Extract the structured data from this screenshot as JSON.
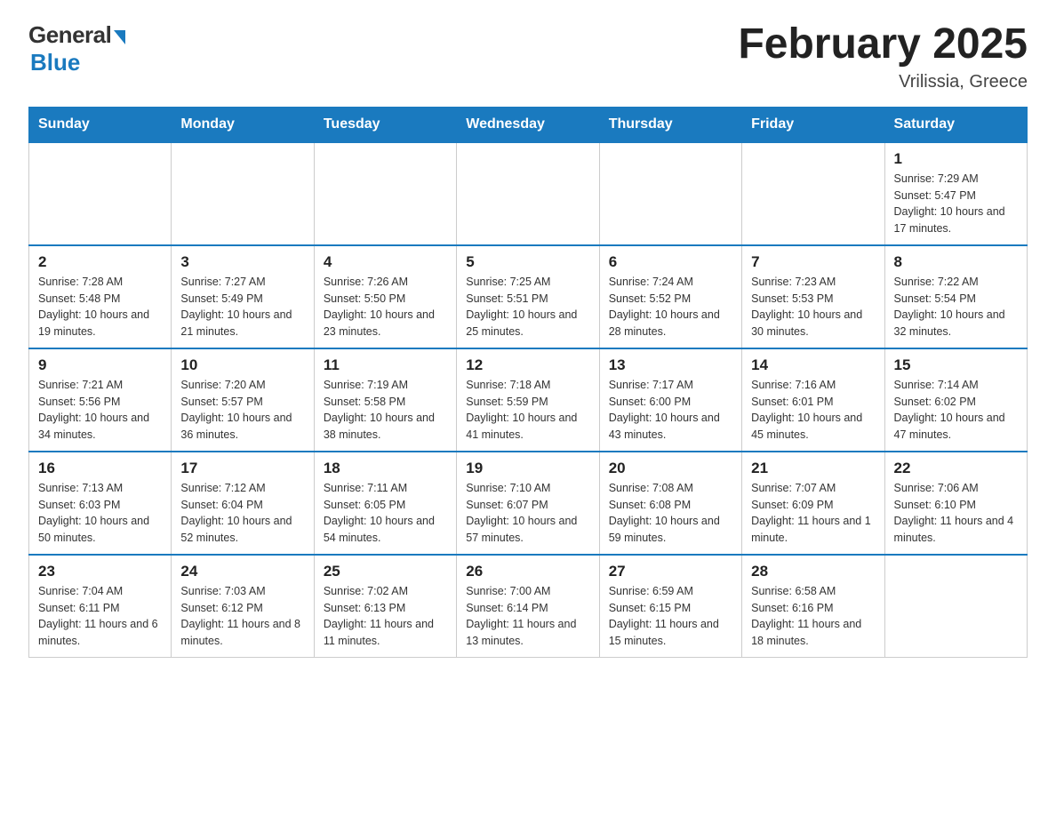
{
  "header": {
    "logo": {
      "general_text": "General",
      "blue_text": "Blue"
    },
    "title": "February 2025",
    "location": "Vrilissia, Greece"
  },
  "weekdays": [
    "Sunday",
    "Monday",
    "Tuesday",
    "Wednesday",
    "Thursday",
    "Friday",
    "Saturday"
  ],
  "weeks": [
    [
      {
        "day": "",
        "info": ""
      },
      {
        "day": "",
        "info": ""
      },
      {
        "day": "",
        "info": ""
      },
      {
        "day": "",
        "info": ""
      },
      {
        "day": "",
        "info": ""
      },
      {
        "day": "",
        "info": ""
      },
      {
        "day": "1",
        "info": "Sunrise: 7:29 AM\nSunset: 5:47 PM\nDaylight: 10 hours and 17 minutes."
      }
    ],
    [
      {
        "day": "2",
        "info": "Sunrise: 7:28 AM\nSunset: 5:48 PM\nDaylight: 10 hours and 19 minutes."
      },
      {
        "day": "3",
        "info": "Sunrise: 7:27 AM\nSunset: 5:49 PM\nDaylight: 10 hours and 21 minutes."
      },
      {
        "day": "4",
        "info": "Sunrise: 7:26 AM\nSunset: 5:50 PM\nDaylight: 10 hours and 23 minutes."
      },
      {
        "day": "5",
        "info": "Sunrise: 7:25 AM\nSunset: 5:51 PM\nDaylight: 10 hours and 25 minutes."
      },
      {
        "day": "6",
        "info": "Sunrise: 7:24 AM\nSunset: 5:52 PM\nDaylight: 10 hours and 28 minutes."
      },
      {
        "day": "7",
        "info": "Sunrise: 7:23 AM\nSunset: 5:53 PM\nDaylight: 10 hours and 30 minutes."
      },
      {
        "day": "8",
        "info": "Sunrise: 7:22 AM\nSunset: 5:54 PM\nDaylight: 10 hours and 32 minutes."
      }
    ],
    [
      {
        "day": "9",
        "info": "Sunrise: 7:21 AM\nSunset: 5:56 PM\nDaylight: 10 hours and 34 minutes."
      },
      {
        "day": "10",
        "info": "Sunrise: 7:20 AM\nSunset: 5:57 PM\nDaylight: 10 hours and 36 minutes."
      },
      {
        "day": "11",
        "info": "Sunrise: 7:19 AM\nSunset: 5:58 PM\nDaylight: 10 hours and 38 minutes."
      },
      {
        "day": "12",
        "info": "Sunrise: 7:18 AM\nSunset: 5:59 PM\nDaylight: 10 hours and 41 minutes."
      },
      {
        "day": "13",
        "info": "Sunrise: 7:17 AM\nSunset: 6:00 PM\nDaylight: 10 hours and 43 minutes."
      },
      {
        "day": "14",
        "info": "Sunrise: 7:16 AM\nSunset: 6:01 PM\nDaylight: 10 hours and 45 minutes."
      },
      {
        "day": "15",
        "info": "Sunrise: 7:14 AM\nSunset: 6:02 PM\nDaylight: 10 hours and 47 minutes."
      }
    ],
    [
      {
        "day": "16",
        "info": "Sunrise: 7:13 AM\nSunset: 6:03 PM\nDaylight: 10 hours and 50 minutes."
      },
      {
        "day": "17",
        "info": "Sunrise: 7:12 AM\nSunset: 6:04 PM\nDaylight: 10 hours and 52 minutes."
      },
      {
        "day": "18",
        "info": "Sunrise: 7:11 AM\nSunset: 6:05 PM\nDaylight: 10 hours and 54 minutes."
      },
      {
        "day": "19",
        "info": "Sunrise: 7:10 AM\nSunset: 6:07 PM\nDaylight: 10 hours and 57 minutes."
      },
      {
        "day": "20",
        "info": "Sunrise: 7:08 AM\nSunset: 6:08 PM\nDaylight: 10 hours and 59 minutes."
      },
      {
        "day": "21",
        "info": "Sunrise: 7:07 AM\nSunset: 6:09 PM\nDaylight: 11 hours and 1 minute."
      },
      {
        "day": "22",
        "info": "Sunrise: 7:06 AM\nSunset: 6:10 PM\nDaylight: 11 hours and 4 minutes."
      }
    ],
    [
      {
        "day": "23",
        "info": "Sunrise: 7:04 AM\nSunset: 6:11 PM\nDaylight: 11 hours and 6 minutes."
      },
      {
        "day": "24",
        "info": "Sunrise: 7:03 AM\nSunset: 6:12 PM\nDaylight: 11 hours and 8 minutes."
      },
      {
        "day": "25",
        "info": "Sunrise: 7:02 AM\nSunset: 6:13 PM\nDaylight: 11 hours and 11 minutes."
      },
      {
        "day": "26",
        "info": "Sunrise: 7:00 AM\nSunset: 6:14 PM\nDaylight: 11 hours and 13 minutes."
      },
      {
        "day": "27",
        "info": "Sunrise: 6:59 AM\nSunset: 6:15 PM\nDaylight: 11 hours and 15 minutes."
      },
      {
        "day": "28",
        "info": "Sunrise: 6:58 AM\nSunset: 6:16 PM\nDaylight: 11 hours and 18 minutes."
      },
      {
        "day": "",
        "info": ""
      }
    ]
  ]
}
